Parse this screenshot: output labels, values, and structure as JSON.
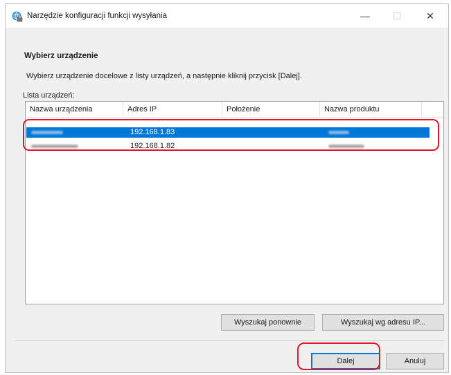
{
  "window": {
    "title": "Narzędzie konfiguracji funkcji wysyłania",
    "minimize_glyph": "—",
    "maximize_glyph": "☐",
    "close_glyph": "✕",
    "icon": "printer-globe-icon"
  },
  "content": {
    "heading": "Wybierz urządzenie",
    "instruction": "Wybierz urządzenie docelowe z listy urządzeń, a następnie kliknij przycisk [Dalej].",
    "list_label": "Lista urządzeń:"
  },
  "device_list": {
    "columns": [
      "Nazwa urządzenia",
      "Adres IP",
      "Położenie",
      "Nazwa produktu"
    ],
    "rows": [
      {
        "name": "",
        "ip": "192.168.1.83",
        "location": "",
        "product": "",
        "selected": true
      },
      {
        "name": "",
        "ip": "192.168.1.82",
        "location": "",
        "product": "",
        "selected": false
      }
    ]
  },
  "buttons": {
    "search_again": "Wyszukaj ponownie",
    "search_by_ip": "Wyszukaj wg adresu IP...",
    "next": "Dalej",
    "cancel": "Anuluj"
  },
  "colors": {
    "selection": "#0078d7",
    "highlight": "#e0142a"
  }
}
